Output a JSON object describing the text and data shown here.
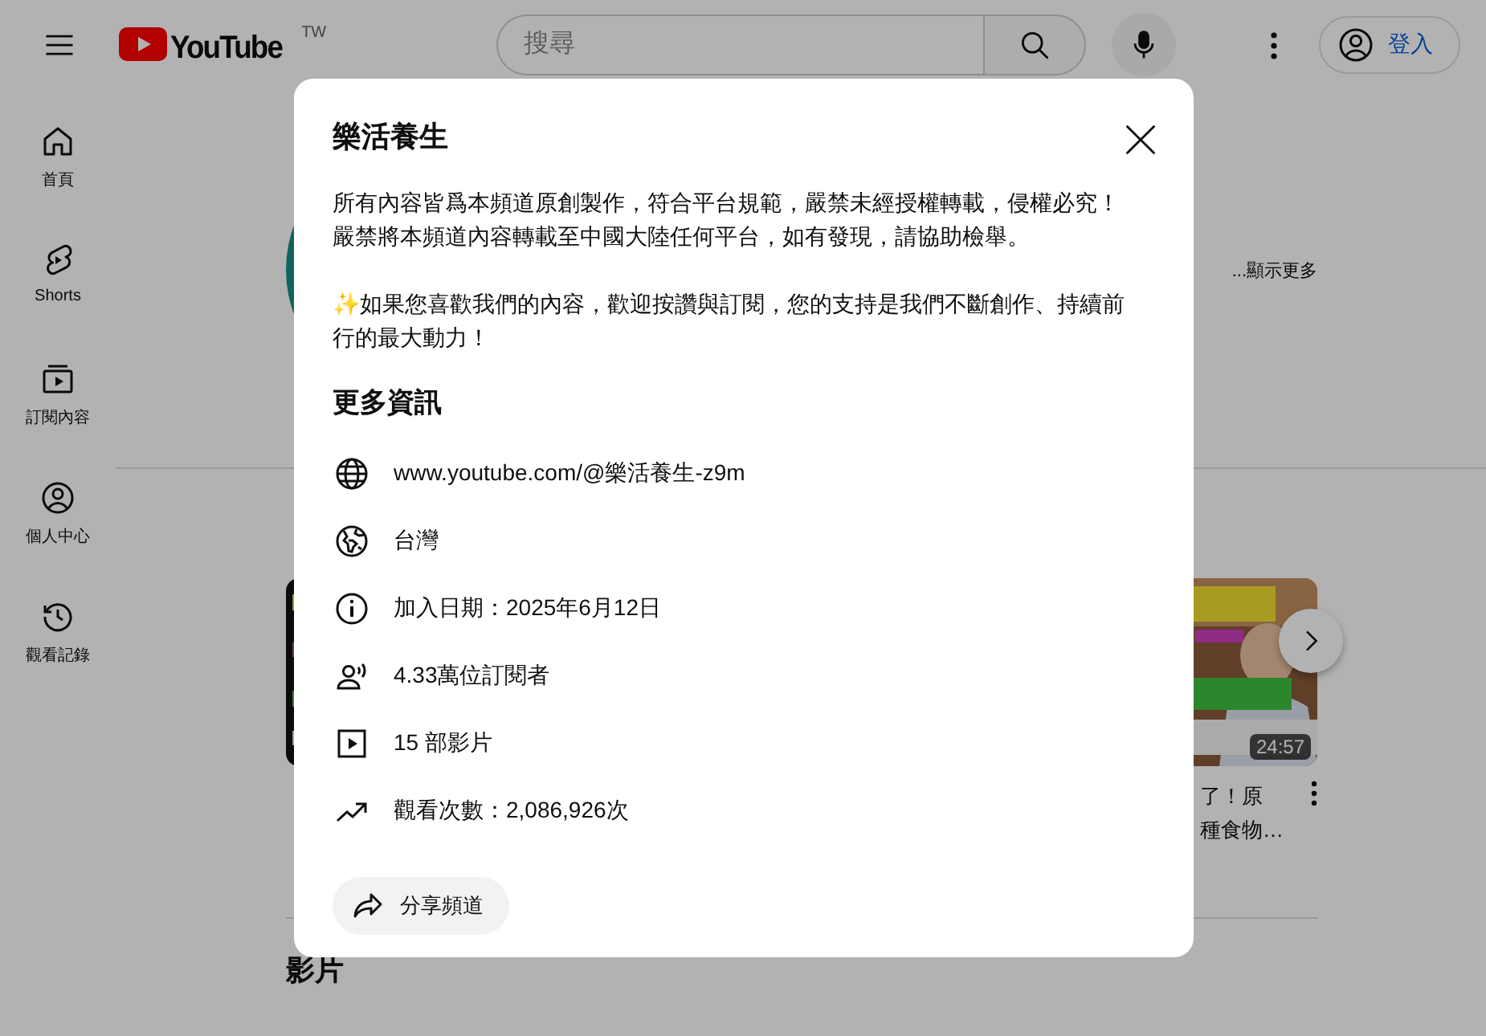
{
  "header": {
    "logo": "YouTube",
    "region": "TW",
    "search": {
      "placeholder": "搜尋"
    },
    "sign_in": "登入"
  },
  "sidebar": {
    "items": [
      {
        "kind": "home",
        "label": "首頁"
      },
      {
        "kind": "shorts",
        "label": "Shorts"
      },
      {
        "kind": "subscriptions",
        "label": "訂閱內容"
      },
      {
        "kind": "you",
        "label": "個人中心"
      },
      {
        "kind": "history",
        "label": "觀看記錄"
      }
    ]
  },
  "channel": {
    "show_more": "...顯示更多"
  },
  "video": {
    "duration": "24:57",
    "title_lines": [
      "了！原",
      "種食物…"
    ]
  },
  "section_title": "影片",
  "dialog": {
    "title": "樂活養生",
    "description": [
      [
        "所有內容皆爲本頻道原創製作，符合平台規範，嚴禁未經授權轉載，侵權必究！",
        "嚴禁將本頻道內容轉載至中國大陸任何平台，如有發現，請協助檢舉。"
      ],
      [
        "✨如果您喜歡我們的內容，歡迎按讚與訂閱，您的支持是我們不斷創作、持續前行的最大動力！"
      ]
    ],
    "more_info_title": "更多資訊",
    "details": [
      {
        "kind": "link",
        "text": "www.youtube.com/@樂活養生-z9m"
      },
      {
        "kind": "country",
        "text": "台灣"
      },
      {
        "kind": "info",
        "text": "加入日期：2025年6月12日"
      },
      {
        "kind": "subscribers",
        "text": "4.33萬位訂閱者"
      },
      {
        "kind": "videos",
        "text": "15 部影片"
      },
      {
        "kind": "views",
        "text": "觀看次數：2,086,926次"
      }
    ],
    "share": "分享頻道"
  }
}
